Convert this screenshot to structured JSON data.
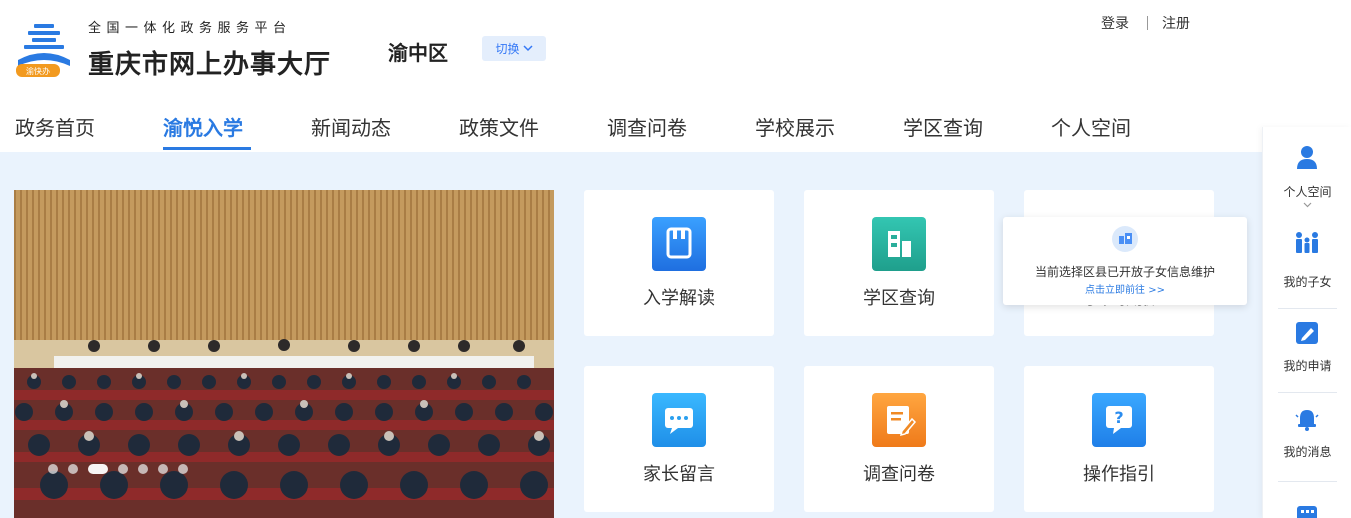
{
  "header": {
    "platform": "全国一体化政务服务平台",
    "title": "重庆市网上办事大厅",
    "logo_text": "渝快办",
    "district": "渝中区",
    "switch_label": "切换",
    "login": "登录",
    "register": "注册"
  },
  "nav": {
    "items": [
      "政务首页",
      "渝悦入学",
      "新闻动态",
      "政策文件",
      "调查问卷",
      "学校展示",
      "学区查询",
      "个人空间"
    ],
    "active_index": 1
  },
  "banner": {
    "slide_count": 8,
    "active_slide": 2
  },
  "tiles": [
    {
      "label": "入学解读",
      "icon": "book-icon",
      "color": "#2f86f0"
    },
    {
      "label": "学区查询",
      "icon": "building-icon",
      "color": "#2fb8a8"
    },
    {
      "label": "学位预报",
      "icon": "school-icon",
      "color": "#4a8ff5"
    },
    {
      "label": "家长留言",
      "icon": "chat-icon",
      "color": "#2fa9ee"
    },
    {
      "label": "调查问卷",
      "icon": "edit-icon",
      "color": "#f0902e"
    },
    {
      "label": "操作指引",
      "icon": "help-icon",
      "color": "#2f95f0"
    }
  ],
  "tooltip": {
    "text": "当前选择区县已开放子女信息维护",
    "link": "点击立即前往 >>"
  },
  "sidebar": {
    "items": [
      {
        "label": "个人空间",
        "icon": "user-icon"
      },
      {
        "label": "我的子女",
        "icon": "family-icon"
      },
      {
        "label": "我的申请",
        "icon": "edit-icon"
      },
      {
        "label": "我的消息",
        "icon": "bell-icon"
      },
      {
        "label": "",
        "icon": "calendar-icon"
      }
    ]
  },
  "colors": {
    "accent": "#2a7ae2",
    "content_bg": "#eaf3fd"
  }
}
